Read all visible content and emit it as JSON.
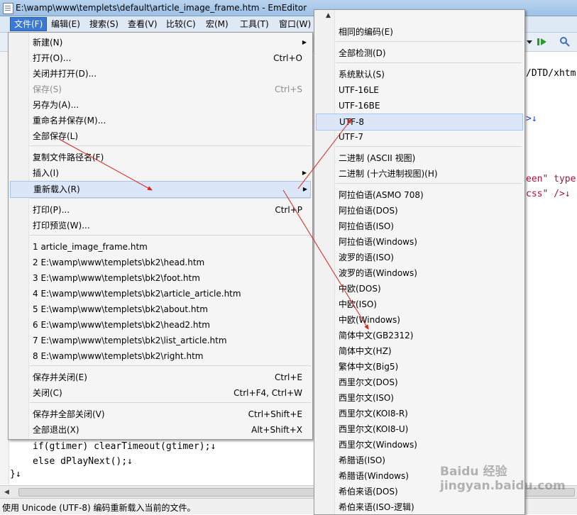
{
  "window": {
    "title": "E:\\wamp\\www\\templets\\default\\article_image_frame.htm - EmEditor"
  },
  "menubar": [
    "文件(F)",
    "编辑(E)",
    "搜索(S)",
    "查看(V)",
    "比较(C)",
    "宏(M)",
    "工具(T)",
    "窗口(W)"
  ],
  "code": {
    "line_dtd": "/DTD/xhtm",
    "line_arrow1": ">↓",
    "line_green": "een\" type",
    "line_css": "css\" />↓",
    "line_if": "if(gtimer) clearTimeout(gtimer);↓",
    "line_else": "else dPlayNext();↓",
    "line_brace": "}↓"
  },
  "status": "使用 Unicode (UTF-8) 编码重新载入当前的文件。",
  "file_menu": [
    {
      "label": "新建(N)",
      "shortcut": "",
      "submenu": true
    },
    {
      "label": "打开(O)...",
      "shortcut": "Ctrl+O"
    },
    {
      "label": "关闭并打开(D)...",
      "shortcut": ""
    },
    {
      "label": "保存(S)",
      "shortcut": "Ctrl+S",
      "disabled": true
    },
    {
      "label": "另存为(A)...",
      "shortcut": ""
    },
    {
      "label": "重命名并保存(M)...",
      "shortcut": ""
    },
    {
      "label": "全部保存(L)",
      "shortcut": ""
    },
    {
      "label": "复制文件路径名(F)",
      "shortcut": ""
    },
    {
      "label": "插入(I)",
      "shortcut": "",
      "submenu": true
    },
    {
      "label": "重新载入(R)",
      "shortcut": "",
      "submenu": true,
      "highlight": true
    },
    {
      "label": "打印(P)...",
      "shortcut": "Ctrl+P"
    },
    {
      "label": "打印预览(W)...",
      "shortcut": ""
    },
    {
      "label": "1 article_image_frame.htm",
      "shortcut": ""
    },
    {
      "label": "2 E:\\wamp\\www\\templets\\bk2\\head.htm",
      "shortcut": ""
    },
    {
      "label": "3 E:\\wamp\\www\\templets\\bk2\\foot.htm",
      "shortcut": ""
    },
    {
      "label": "4 E:\\wamp\\www\\templets\\bk2\\article_article.htm",
      "shortcut": ""
    },
    {
      "label": "5 E:\\wamp\\www\\templets\\bk2\\about.htm",
      "shortcut": ""
    },
    {
      "label": "6 E:\\wamp\\www\\templets\\bk2\\head2.htm",
      "shortcut": ""
    },
    {
      "label": "7 E:\\wamp\\www\\templets\\bk2\\list_article.htm",
      "shortcut": ""
    },
    {
      "label": "8 E:\\wamp\\www\\templets\\bk2\\right.htm",
      "shortcut": ""
    },
    {
      "label": "保存并关闭(E)",
      "shortcut": "Ctrl+E"
    },
    {
      "label": "关闭(C)",
      "shortcut": "Ctrl+F4, Ctrl+W"
    },
    {
      "label": "保存并全部关闭(V)",
      "shortcut": "Ctrl+Shift+E"
    },
    {
      "label": "全部退出(X)",
      "shortcut": "Alt+Shift+X"
    }
  ],
  "encoding_menu": [
    "相同的编码(E)",
    "全部检测(D)",
    "系统默认(S)",
    "UTF-16LE",
    "UTF-16BE",
    "UTF-8",
    "UTF-7",
    "二进制 (ASCII 视图)",
    "二进制 (十六进制视图)(H)",
    "阿拉伯语(ASMO 708)",
    "阿拉伯语(DOS)",
    "阿拉伯语(ISO)",
    "阿拉伯语(Windows)",
    "波罗的语(ISO)",
    "波罗的语(Windows)",
    "中欧(DOS)",
    "中欧(ISO)",
    "中欧(Windows)",
    "简体中文(GB2312)",
    "简体中文(HZ)",
    "繁体中文(Big5)",
    "西里尔文(DOS)",
    "西里尔文(ISO)",
    "西里尔文(KOI8-R)",
    "西里尔文(KOI8-U)",
    "西里尔文(Windows)",
    "希腊语(ISO)",
    "希腊语(Windows)",
    "希伯来语(DOS)",
    "希伯来语(ISO-逻辑)"
  ],
  "watermark": "Baidu 经验 jingyan.baidu.com",
  "colors": {
    "annotation_arrow": "#e0201c",
    "menu_highlight": "#3a79d3"
  }
}
